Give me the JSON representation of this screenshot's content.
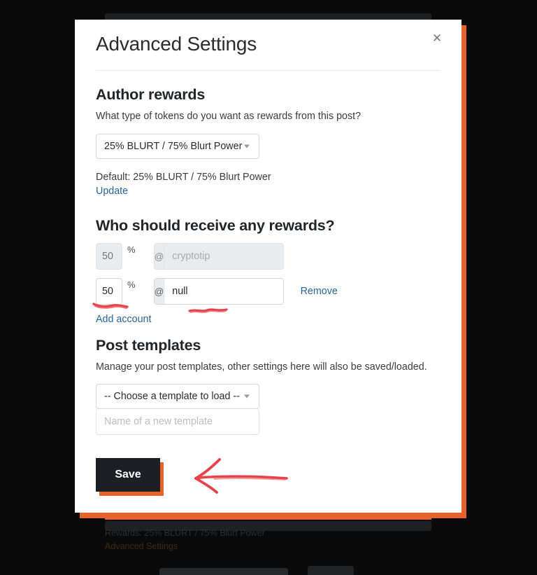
{
  "modal": {
    "title": "Advanced Settings",
    "close_icon": "close-icon",
    "author_rewards": {
      "heading": "Author rewards",
      "question": "What type of tokens do you want as rewards from this post?",
      "reward_select_value": "25% BLURT / 75% Blurt Power",
      "default_label": "Default: 25% BLURT / 75% Blurt Power",
      "update_link": "Update"
    },
    "beneficiaries": {
      "heading": "Who should receive any rewards?",
      "percent_symbol": "%",
      "at_symbol": "@",
      "rows": [
        {
          "percent_value": "",
          "percent_placeholder": "50",
          "account_value": "",
          "account_placeholder": "cryptotip",
          "disabled": true,
          "remove_label": ""
        },
        {
          "percent_value": "50",
          "percent_placeholder": "50",
          "account_value": "null",
          "account_placeholder": "",
          "disabled": false,
          "remove_label": "Remove"
        }
      ],
      "add_account_link": "Add account"
    },
    "post_templates": {
      "heading": "Post templates",
      "description": "Manage your post templates, other settings here will also be saved/loaded.",
      "template_select_value": "-- Choose a template to load --",
      "new_template_placeholder": "Name of a new template"
    },
    "save_label": "Save"
  },
  "background": {
    "rewards_line": "Rewards: 25% BLURT / 75% Blurt Power",
    "advanced_settings_link": "Advanced Settings"
  },
  "colors": {
    "accent_orange": "#e8622c",
    "link_blue": "#2a6496",
    "dark_button": "#1c2025",
    "annotation_red": "#e8414a",
    "disabled_grey": "#e9ecef"
  }
}
